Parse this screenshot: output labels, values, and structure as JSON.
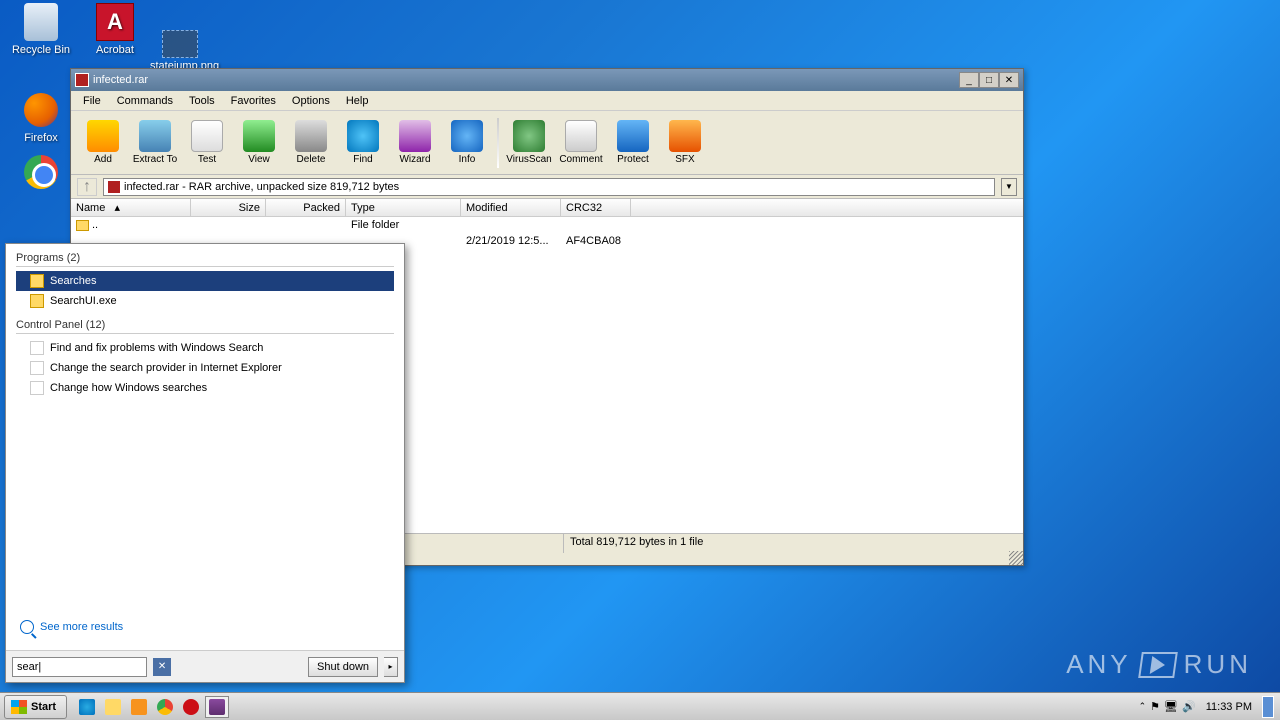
{
  "desktop": {
    "recycle": "Recycle Bin",
    "acrobat": "Acrobat",
    "firefox": "Firefox",
    "statefile": "statejump.png"
  },
  "window": {
    "title": "infected.rar",
    "menu": {
      "file": "File",
      "commands": "Commands",
      "tools": "Tools",
      "favorites": "Favorites",
      "options": "Options",
      "help": "Help"
    },
    "toolbar": {
      "add": "Add",
      "extract": "Extract To",
      "test": "Test",
      "view": "View",
      "delete": "Delete",
      "find": "Find",
      "wizard": "Wizard",
      "info": "Info",
      "virusscan": "VirusScan",
      "comment": "Comment",
      "protect": "Protect",
      "sfx": "SFX"
    },
    "path": "infected.rar - RAR archive, unpacked size 819,712 bytes",
    "columns": {
      "name": "Name",
      "size": "Size",
      "packed": "Packed",
      "type": "Type",
      "modified": "Modified",
      "crc": "CRC32"
    },
    "rows": {
      "up": {
        "name": "..",
        "type": "File folder"
      },
      "r1": {
        "modified": "2/21/2019 12:5...",
        "crc": "AF4CBA08"
      }
    },
    "status": "Total 819,712 bytes in 1 file"
  },
  "startmenu": {
    "programs_title": "Programs (2)",
    "item_searches": "Searches",
    "item_searchui": "SearchUI.exe",
    "cp_title": "Control Panel (12)",
    "cp1": "Find and fix problems with Windows Search",
    "cp2": "Change the search provider in Internet Explorer",
    "cp3": "Change how Windows searches",
    "seemore": "See more results",
    "search_value": "sear",
    "shutdown": "Shut down"
  },
  "taskbar": {
    "start": "Start",
    "time": "11:33 PM"
  },
  "watermark": {
    "any": "ANY",
    "run": "RUN"
  }
}
